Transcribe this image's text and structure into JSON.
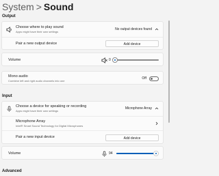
{
  "header": {
    "crumb": "System",
    "separator": ">",
    "current": "Sound"
  },
  "output": {
    "section_label": "Output",
    "choose_title": "Choose where to play sound",
    "choose_sub": "Apps might have their own settings",
    "choose_value": "No output devices found",
    "pair_label": "Pair a new output device",
    "pair_button": "Add device",
    "volume_label": "Volume",
    "volume_value": "0",
    "volume_level": 0,
    "mono_title": "Mono audio",
    "mono_sub": "Combine left and right audio channels into one",
    "mono_state": "Off"
  },
  "input": {
    "section_label": "Input",
    "choose_title": "Choose a device for speaking or recording",
    "choose_sub": "Apps might have their own settings",
    "choose_value": "Microphone Array",
    "mic_title": "Microphone Array",
    "mic_sub": "Intel® Smart Sound Technology for Digital Microphones",
    "pair_label": "Pair a new input device",
    "pair_button": "Add device",
    "volume_label": "Volume",
    "volume_value": "94",
    "volume_level": 0.94
  },
  "advanced": {
    "section_label": "Advanced"
  },
  "colors": {
    "accent": "#005fb8",
    "background": "#f3f3f3",
    "card": "#fbfbfb"
  },
  "icons": [
    "speaker-icon",
    "mute-speaker-icon",
    "microphone-icon",
    "chevron-up-icon",
    "chevron-right-icon"
  ]
}
